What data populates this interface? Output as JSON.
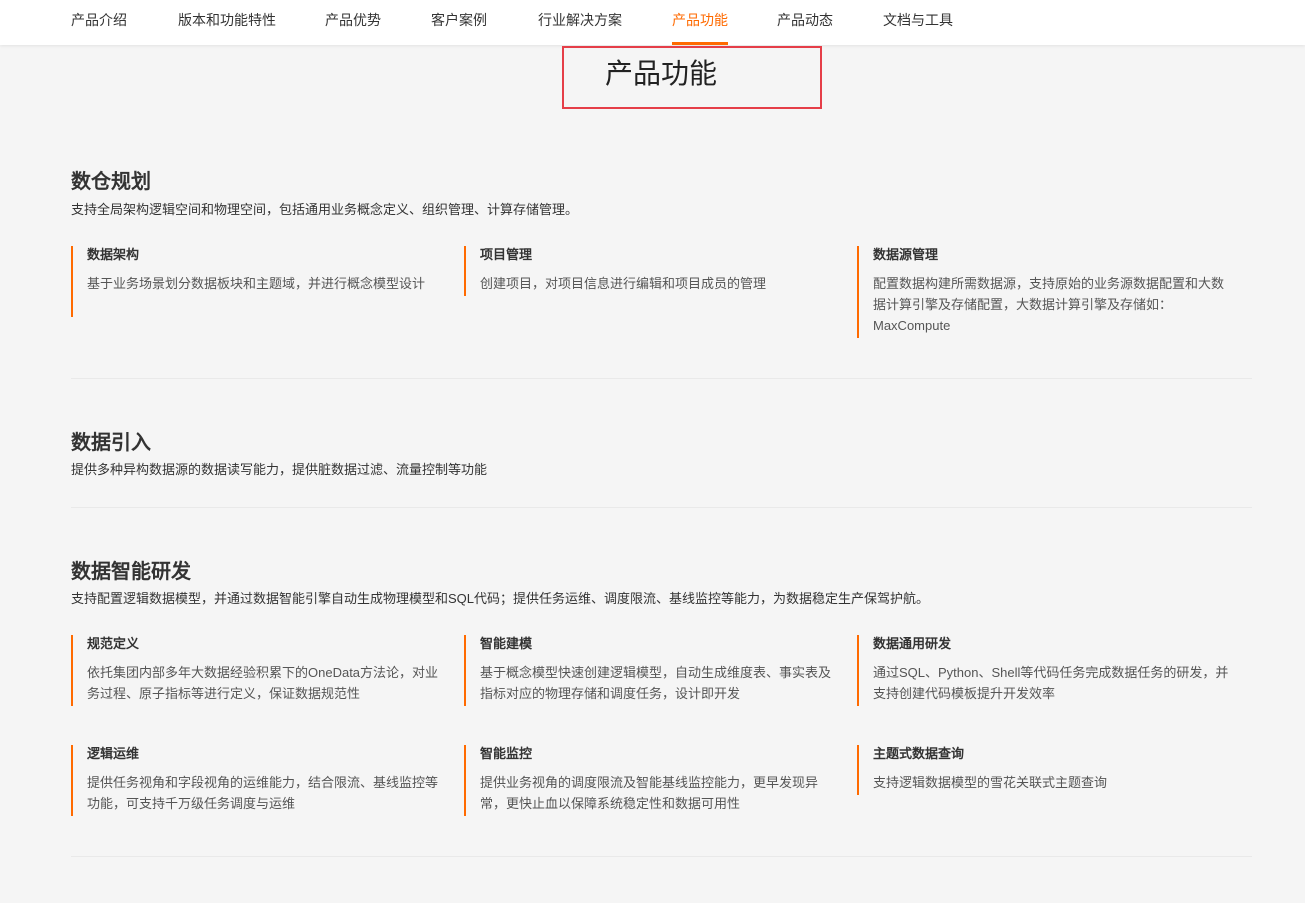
{
  "nav": {
    "items": [
      {
        "label": "产品介绍"
      },
      {
        "label": "版本和功能特性"
      },
      {
        "label": "产品优势"
      },
      {
        "label": "客户案例"
      },
      {
        "label": "行业解决方案"
      },
      {
        "label": "产品功能"
      },
      {
        "label": "产品动态"
      },
      {
        "label": "文档与工具"
      }
    ],
    "active": "产品功能"
  },
  "page_title": "产品功能",
  "sections": [
    {
      "title": "数仓规划",
      "desc": "支持全局架构逻辑空间和物理空间，包括通用业务概念定义、组织管理、计算存储管理。",
      "cards": [
        {
          "title": "数据架构",
          "desc": "基于业务场景划分数据板块和主题域，并进行概念模型设计"
        },
        {
          "title": "项目管理",
          "desc": "创建项目，对项目信息进行编辑和项目成员的管理"
        },
        {
          "title": "数据源管理",
          "desc": "配置数据构建所需数据源，支持原始的业务源数据配置和大数据计算引擎及存储配置，大数据计算引擎及存储如：MaxCompute"
        }
      ]
    },
    {
      "title": "数据引入",
      "desc": "提供多种异构数据源的数据读写能力，提供脏数据过滤、流量控制等功能",
      "cards": []
    },
    {
      "title": "数据智能研发",
      "desc": "支持配置逻辑数据模型，并通过数据智能引擎自动生成物理模型和SQL代码；提供任务运维、调度限流、基线监控等能力，为数据稳定生产保驾护航。",
      "cards": [
        {
          "title": "规范定义",
          "desc": "依托集团内部多年大数据经验积累下的OneData方法论，对业务过程、原子指标等进行定义，保证数据规范性"
        },
        {
          "title": "智能建模",
          "desc": "基于概念模型快速创建逻辑模型，自动生成维度表、事实表及指标对应的物理存储和调度任务，设计即开发"
        },
        {
          "title": "数据通用研发",
          "desc": "通过SQL、Python、Shell等代码任务完成数据任务的研发，并支持创建代码模板提升开发效率"
        },
        {
          "title": "逻辑运维",
          "desc": "提供任务视角和字段视角的运维能力，结合限流、基线监控等功能，可支持千万级任务调度与运维"
        },
        {
          "title": "智能监控",
          "desc": "提供业务视角的调度限流及智能基线监控能力，更早发现异常，更快止血以保障系统稳定性和数据可用性"
        },
        {
          "title": "主题式数据查询",
          "desc": "支持逻辑数据模型的雪花关联式主题查询"
        }
      ]
    }
  ],
  "colors": {
    "accent": "#ff6a00",
    "highlight_box": "#e53e48",
    "background": "#f5f5f5"
  }
}
